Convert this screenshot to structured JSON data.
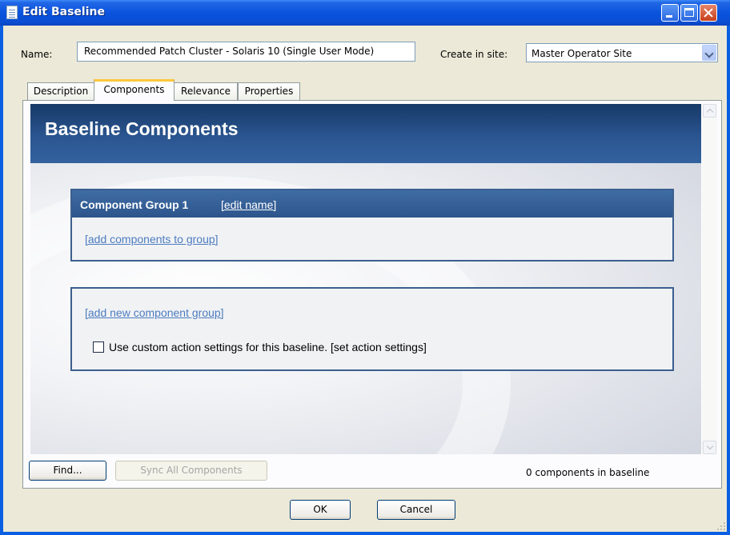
{
  "window": {
    "title": "Edit Baseline",
    "colors": {
      "titlebar": "#0A53DD",
      "header": "#173A67",
      "link": "#4C7CC0",
      "focus_tab": "#FFC83C"
    }
  },
  "form": {
    "name_label": "Name:",
    "name_value": "Recommended Patch Cluster - Solaris 10 (Single User Mode)",
    "site_label": "Create in site:",
    "site_value": "Master Operator Site"
  },
  "tabs": [
    {
      "label": "Description",
      "active": false
    },
    {
      "label": "Components",
      "active": true
    },
    {
      "label": "Relevance",
      "active": false
    },
    {
      "label": "Properties",
      "active": false
    }
  ],
  "content": {
    "title": "Baseline Components",
    "group": {
      "title": "Component Group 1",
      "edit_link": "[edit name]",
      "add_link": "[add components to group]"
    },
    "add_group_link": "[add new component group]",
    "custom_action": {
      "checked": false,
      "label": "Use custom action settings for this baseline. [set action settings]"
    }
  },
  "bottom": {
    "find_label": "Find...",
    "sync_label": "Sync All Components",
    "count_text": "0 components in baseline"
  },
  "dialog": {
    "ok_label": "OK",
    "cancel_label": "Cancel"
  },
  "icons": [
    "document-icon",
    "minimize-icon",
    "maximize-icon",
    "close-icon",
    "chevron-down-icon",
    "scroll-up-icon",
    "scroll-down-icon",
    "resize-grip-icon"
  ]
}
